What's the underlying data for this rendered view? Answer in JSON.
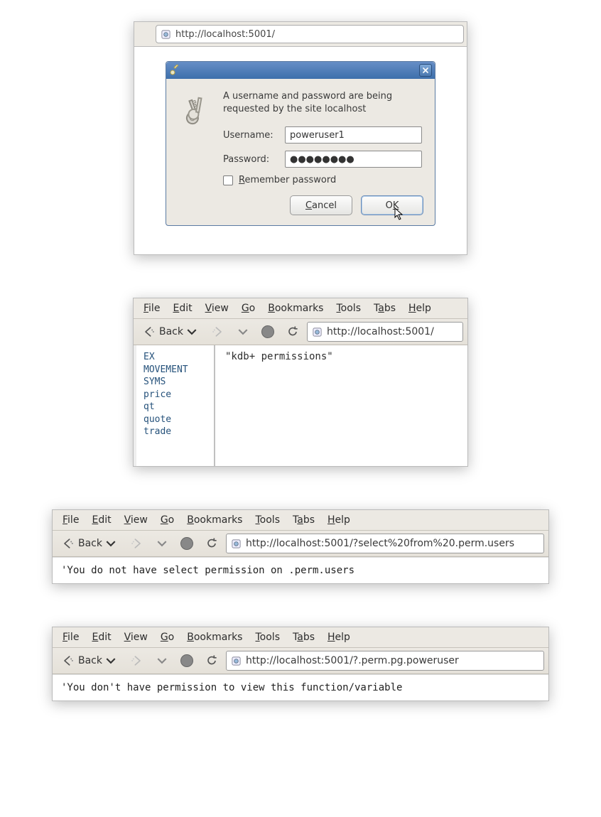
{
  "block1": {
    "url": "http://localhost:5001/",
    "dialog": {
      "message": "A username and password are being requested by the site localhost",
      "username_label": "Username:",
      "password_label": "Password:",
      "username_value": "poweruser1",
      "password_value": "●●●●●●●●",
      "remember_label": "Remember password",
      "cancel_label": "Cancel",
      "ok_label": "OK"
    }
  },
  "menu": {
    "file": "File",
    "edit": "Edit",
    "view": "View",
    "go": "Go",
    "bookmarks": "Bookmarks",
    "tools": "Tools",
    "tabs": "Tabs",
    "help": "Help"
  },
  "toolbar": {
    "back_label": "Back"
  },
  "block2": {
    "url": "http://localhost:5001/",
    "sidebar_items": [
      "EX",
      "MOVEMENT",
      "SYMS",
      "price",
      "qt",
      "quote",
      "trade"
    ],
    "content": "\"kdb+ permissions\""
  },
  "block3": {
    "url": "http://localhost:5001/?select%20from%20.perm.users",
    "content": "'You do not have select permission on .perm.users"
  },
  "block4": {
    "url": "http://localhost:5001/?.perm.pg.poweruser",
    "content": "'You don't have permission to view this function/variable"
  }
}
